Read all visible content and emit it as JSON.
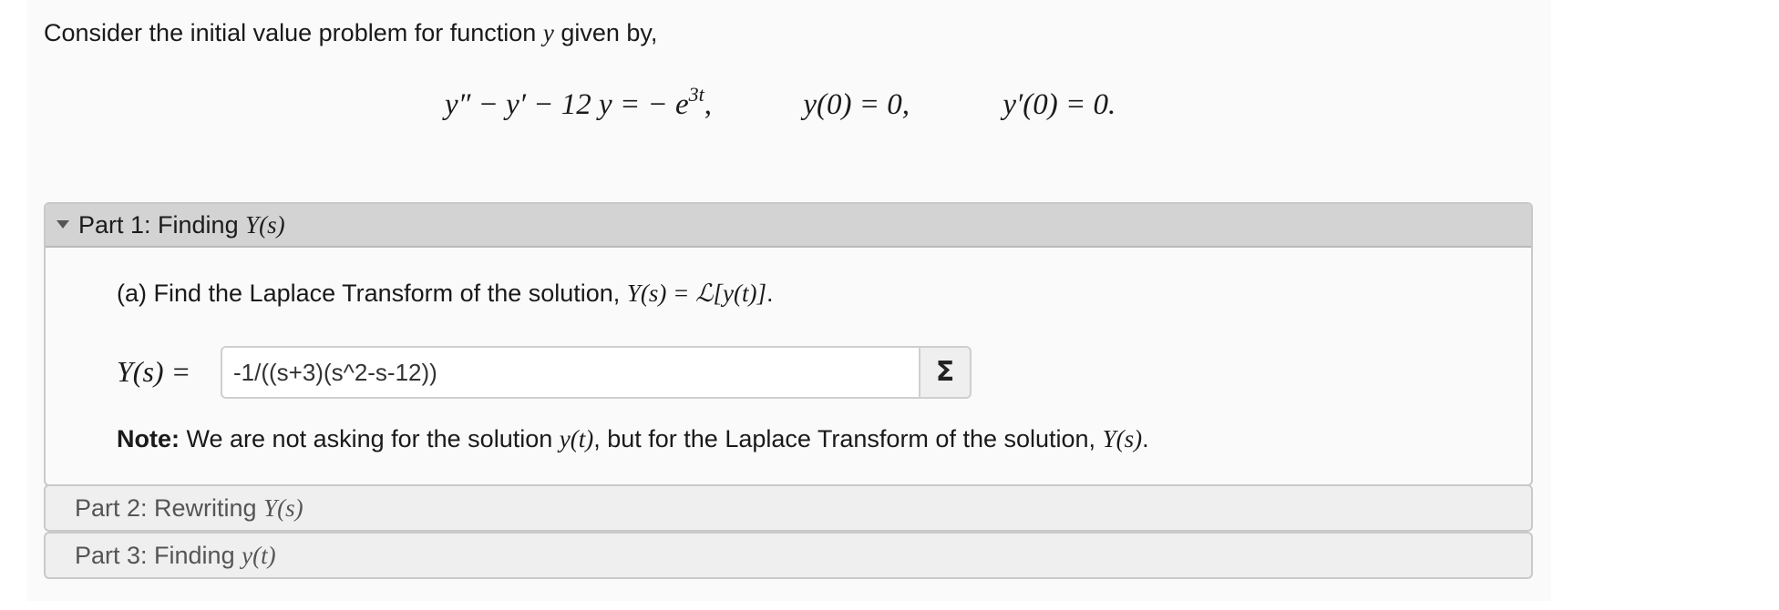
{
  "intro": {
    "text_before": "Consider the initial value problem for function",
    "variable": "y",
    "text_after": "given by,"
  },
  "equation": {
    "ode_lhs": "y″ − y′ − 12 y = − e",
    "ode_exponent": "3t",
    "ode_comma": ",",
    "ic1": "y(0) = 0,",
    "ic2": "y′(0) = 0."
  },
  "part1": {
    "title_text": "Part 1: Finding",
    "title_math": "Y(s)",
    "question_text": "(a) Find the Laplace Transform of the solution,",
    "question_math": "Y(s) = ℒ[y(t)]",
    "question_end": ".",
    "answer_label": "Y(s) =",
    "answer_value": "-1/((s+3)(s^2-s-12))",
    "sigma_label": "Σ",
    "note_bold": "Note:",
    "note_text_1": "We are not asking for the solution",
    "note_math_1": "y(t)",
    "note_text_2": ", but for the Laplace Transform of the solution,",
    "note_math_2": "Y(s)",
    "note_end": "."
  },
  "part2": {
    "title_text": "Part 2: Rewriting",
    "title_math": "Y(s)"
  },
  "part3": {
    "title_text": "Part 3: Finding",
    "title_math": "y(t)"
  },
  "colors": {
    "expanded_header_bg": "#d3d3d3",
    "collapsed_header_bg": "#efefef",
    "border": "#c9c9c9"
  }
}
